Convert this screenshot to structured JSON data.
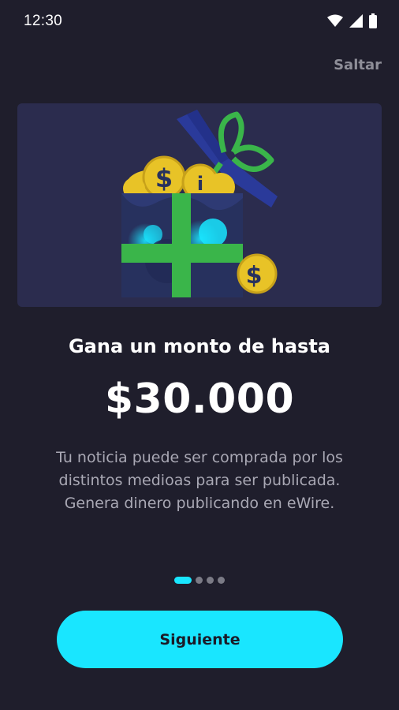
{
  "status_bar": {
    "time": "12:30",
    "icons": [
      "wifi-icon",
      "signal-icon",
      "battery-icon"
    ]
  },
  "header": {
    "skip_label": "Saltar"
  },
  "hero": {
    "illustration": "gift-box-with-coins",
    "colors": {
      "background": "#2b2c4e",
      "box": "#27315e",
      "ribbon": "#3ab54a",
      "coin": "#e8c327",
      "glow": "#19e6ff"
    }
  },
  "content": {
    "title": "Gana un monto de hasta",
    "amount": "$30.000",
    "description": "Tu noticia puede ser comprada por los distintos medioas para ser publicada. Genera dinero publicando en eWire."
  },
  "pager": {
    "total": 4,
    "current": 1
  },
  "footer": {
    "next_label": "Siguiente"
  },
  "theme": {
    "background": "#1f1e2c",
    "accent": "#19e6ff",
    "muted_text": "#a9a8b4"
  }
}
